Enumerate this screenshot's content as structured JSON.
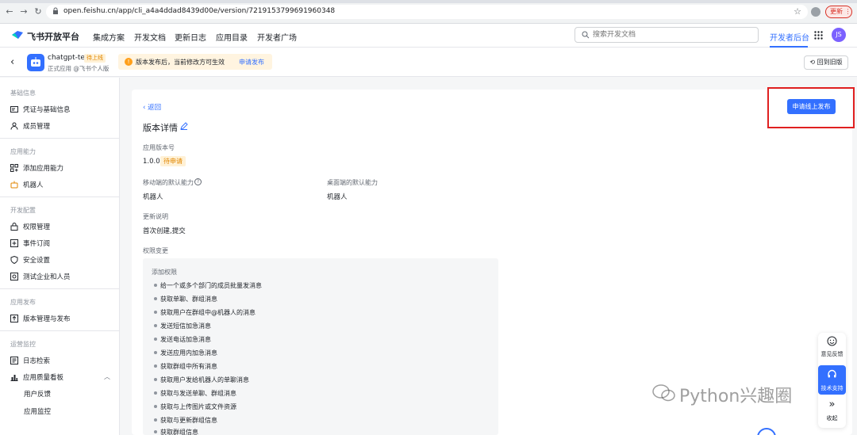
{
  "browser": {
    "url": "open.feishu.cn/app/cli_a4a4ddad8439d00e/version/7219153799691960348",
    "update_label": "更新"
  },
  "header": {
    "brand": "飞书开放平台",
    "nav": [
      "集成方案",
      "开发文档",
      "更新日志",
      "应用目录",
      "开发者广场"
    ],
    "search_placeholder": "搜索开发文档",
    "dev_console": "开发者后台",
    "avatar_initials": "JS"
  },
  "app": {
    "name": "chatgpt-test",
    "status_badge": "待上线",
    "type": "正式应用 @飞书个人版",
    "notice_text": "版本发布后，当前修改方可生效",
    "notice_link": "申请发布",
    "old_version_label": "回到旧版"
  },
  "sidebar": {
    "groups": [
      {
        "title": "基础信息",
        "items": [
          "凭证与基础信息",
          "成员管理"
        ]
      },
      {
        "title": "应用能力",
        "items": [
          "添加应用能力",
          "机器人"
        ]
      },
      {
        "title": "开发配置",
        "items": [
          "权限管理",
          "事件订阅",
          "安全设置",
          "测试企业和人员"
        ]
      },
      {
        "title": "应用发布",
        "items": [
          "版本管理与发布"
        ]
      },
      {
        "title": "运营监控",
        "items": [
          "日志检索",
          "应用质量看板"
        ]
      }
    ],
    "sub_items": [
      "用户反馈",
      "应用监控"
    ]
  },
  "main": {
    "back": "返回",
    "title": "版本详情",
    "publish_button": "申请线上发布",
    "version_label": "应用版本号",
    "version_value": "1.0.0",
    "version_status": "待申请",
    "mobile_label": "移动端的默认能力",
    "mobile_value": "机器人",
    "desktop_label": "桌面端的默认能力",
    "desktop_value": "机器人",
    "notes_label": "更新说明",
    "notes_value": "首次创建,提交",
    "perm_label": "权限变更",
    "perm_title": "添加权限",
    "permissions": [
      "给一个或多个部门的成员批量发消息",
      "获取单聊、群组消息",
      "获取用户在群组中@机器人的消息",
      "发送短信加急消息",
      "发送电话加急消息",
      "发送应用内加急消息",
      "获取群组中所有消息",
      "获取用户发给机器人的单聊消息",
      "获取与发送单聊、群组消息",
      "获取与上传图片或文件资源",
      "获取与更新群组信息",
      "获取群组信息"
    ]
  },
  "floating": {
    "feedback": "意见反馈",
    "support": "技术支持",
    "collapse": "收起"
  },
  "watermark": "Python兴趣圈",
  "colors": {
    "accent": "#3370ff",
    "highlight_box": "#e02020",
    "badge_bg": "#fff1d6",
    "badge_text": "#e08600"
  }
}
